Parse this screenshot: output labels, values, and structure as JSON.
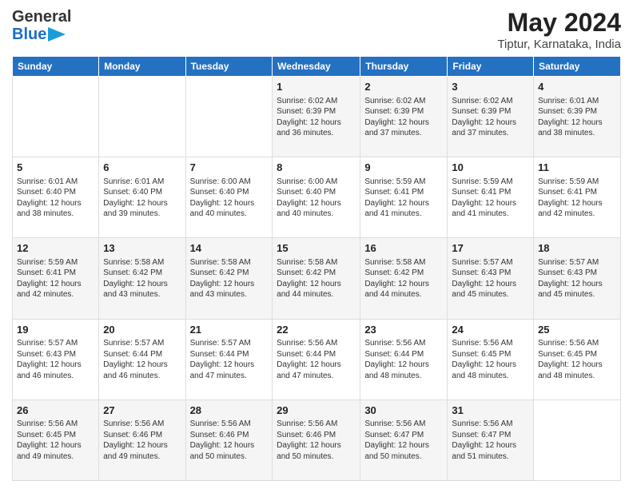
{
  "header": {
    "logo_general": "General",
    "logo_blue": "Blue",
    "month_year": "May 2024",
    "location": "Tiptur, Karnataka, India"
  },
  "days_of_week": [
    "Sunday",
    "Monday",
    "Tuesday",
    "Wednesday",
    "Thursday",
    "Friday",
    "Saturday"
  ],
  "weeks": [
    [
      {
        "day": "",
        "sunrise": "",
        "sunset": "",
        "daylight": ""
      },
      {
        "day": "",
        "sunrise": "",
        "sunset": "",
        "daylight": ""
      },
      {
        "day": "",
        "sunrise": "",
        "sunset": "",
        "daylight": ""
      },
      {
        "day": "1",
        "sunrise": "Sunrise: 6:02 AM",
        "sunset": "Sunset: 6:39 PM",
        "daylight": "Daylight: 12 hours and 36 minutes."
      },
      {
        "day": "2",
        "sunrise": "Sunrise: 6:02 AM",
        "sunset": "Sunset: 6:39 PM",
        "daylight": "Daylight: 12 hours and 37 minutes."
      },
      {
        "day": "3",
        "sunrise": "Sunrise: 6:02 AM",
        "sunset": "Sunset: 6:39 PM",
        "daylight": "Daylight: 12 hours and 37 minutes."
      },
      {
        "day": "4",
        "sunrise": "Sunrise: 6:01 AM",
        "sunset": "Sunset: 6:39 PM",
        "daylight": "Daylight: 12 hours and 38 minutes."
      }
    ],
    [
      {
        "day": "5",
        "sunrise": "Sunrise: 6:01 AM",
        "sunset": "Sunset: 6:40 PM",
        "daylight": "Daylight: 12 hours and 38 minutes."
      },
      {
        "day": "6",
        "sunrise": "Sunrise: 6:01 AM",
        "sunset": "Sunset: 6:40 PM",
        "daylight": "Daylight: 12 hours and 39 minutes."
      },
      {
        "day": "7",
        "sunrise": "Sunrise: 6:00 AM",
        "sunset": "Sunset: 6:40 PM",
        "daylight": "Daylight: 12 hours and 40 minutes."
      },
      {
        "day": "8",
        "sunrise": "Sunrise: 6:00 AM",
        "sunset": "Sunset: 6:40 PM",
        "daylight": "Daylight: 12 hours and 40 minutes."
      },
      {
        "day": "9",
        "sunrise": "Sunrise: 5:59 AM",
        "sunset": "Sunset: 6:41 PM",
        "daylight": "Daylight: 12 hours and 41 minutes."
      },
      {
        "day": "10",
        "sunrise": "Sunrise: 5:59 AM",
        "sunset": "Sunset: 6:41 PM",
        "daylight": "Daylight: 12 hours and 41 minutes."
      },
      {
        "day": "11",
        "sunrise": "Sunrise: 5:59 AM",
        "sunset": "Sunset: 6:41 PM",
        "daylight": "Daylight: 12 hours and 42 minutes."
      }
    ],
    [
      {
        "day": "12",
        "sunrise": "Sunrise: 5:59 AM",
        "sunset": "Sunset: 6:41 PM",
        "daylight": "Daylight: 12 hours and 42 minutes."
      },
      {
        "day": "13",
        "sunrise": "Sunrise: 5:58 AM",
        "sunset": "Sunset: 6:42 PM",
        "daylight": "Daylight: 12 hours and 43 minutes."
      },
      {
        "day": "14",
        "sunrise": "Sunrise: 5:58 AM",
        "sunset": "Sunset: 6:42 PM",
        "daylight": "Daylight: 12 hours and 43 minutes."
      },
      {
        "day": "15",
        "sunrise": "Sunrise: 5:58 AM",
        "sunset": "Sunset: 6:42 PM",
        "daylight": "Daylight: 12 hours and 44 minutes."
      },
      {
        "day": "16",
        "sunrise": "Sunrise: 5:58 AM",
        "sunset": "Sunset: 6:42 PM",
        "daylight": "Daylight: 12 hours and 44 minutes."
      },
      {
        "day": "17",
        "sunrise": "Sunrise: 5:57 AM",
        "sunset": "Sunset: 6:43 PM",
        "daylight": "Daylight: 12 hours and 45 minutes."
      },
      {
        "day": "18",
        "sunrise": "Sunrise: 5:57 AM",
        "sunset": "Sunset: 6:43 PM",
        "daylight": "Daylight: 12 hours and 45 minutes."
      }
    ],
    [
      {
        "day": "19",
        "sunrise": "Sunrise: 5:57 AM",
        "sunset": "Sunset: 6:43 PM",
        "daylight": "Daylight: 12 hours and 46 minutes."
      },
      {
        "day": "20",
        "sunrise": "Sunrise: 5:57 AM",
        "sunset": "Sunset: 6:44 PM",
        "daylight": "Daylight: 12 hours and 46 minutes."
      },
      {
        "day": "21",
        "sunrise": "Sunrise: 5:57 AM",
        "sunset": "Sunset: 6:44 PM",
        "daylight": "Daylight: 12 hours and 47 minutes."
      },
      {
        "day": "22",
        "sunrise": "Sunrise: 5:56 AM",
        "sunset": "Sunset: 6:44 PM",
        "daylight": "Daylight: 12 hours and 47 minutes."
      },
      {
        "day": "23",
        "sunrise": "Sunrise: 5:56 AM",
        "sunset": "Sunset: 6:44 PM",
        "daylight": "Daylight: 12 hours and 48 minutes."
      },
      {
        "day": "24",
        "sunrise": "Sunrise: 5:56 AM",
        "sunset": "Sunset: 6:45 PM",
        "daylight": "Daylight: 12 hours and 48 minutes."
      },
      {
        "day": "25",
        "sunrise": "Sunrise: 5:56 AM",
        "sunset": "Sunset: 6:45 PM",
        "daylight": "Daylight: 12 hours and 48 minutes."
      }
    ],
    [
      {
        "day": "26",
        "sunrise": "Sunrise: 5:56 AM",
        "sunset": "Sunset: 6:45 PM",
        "daylight": "Daylight: 12 hours and 49 minutes."
      },
      {
        "day": "27",
        "sunrise": "Sunrise: 5:56 AM",
        "sunset": "Sunset: 6:46 PM",
        "daylight": "Daylight: 12 hours and 49 minutes."
      },
      {
        "day": "28",
        "sunrise": "Sunrise: 5:56 AM",
        "sunset": "Sunset: 6:46 PM",
        "daylight": "Daylight: 12 hours and 50 minutes."
      },
      {
        "day": "29",
        "sunrise": "Sunrise: 5:56 AM",
        "sunset": "Sunset: 6:46 PM",
        "daylight": "Daylight: 12 hours and 50 minutes."
      },
      {
        "day": "30",
        "sunrise": "Sunrise: 5:56 AM",
        "sunset": "Sunset: 6:47 PM",
        "daylight": "Daylight: 12 hours and 50 minutes."
      },
      {
        "day": "31",
        "sunrise": "Sunrise: 5:56 AM",
        "sunset": "Sunset: 6:47 PM",
        "daylight": "Daylight: 12 hours and 51 minutes."
      },
      {
        "day": "",
        "sunrise": "",
        "sunset": "",
        "daylight": ""
      }
    ]
  ]
}
